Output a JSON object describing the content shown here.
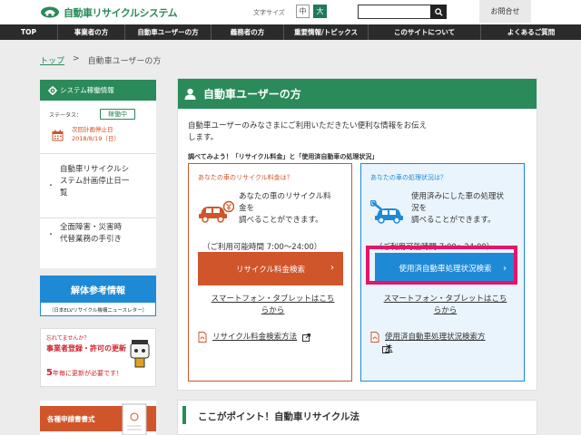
{
  "header": {
    "logo_text": "自動車リサイクルシステム",
    "font_size_label": "文字サイズ",
    "font_size_medium": "中",
    "font_size_large": "大",
    "search_placeholder": "",
    "inquiry": "お問合せ"
  },
  "nav": {
    "items": [
      "TOP",
      "事業者の方",
      "自動車ユーザーの方",
      "義務者の方",
      "重要情報/トピックス",
      "このサイトについて",
      "よくあるご質問"
    ]
  },
  "breadcrumb": {
    "home": "トップ",
    "separator": ">",
    "current": "自動車ユーザーの方"
  },
  "sidebar": {
    "status_title": "システム稼働情報",
    "status_label": "ステータス：",
    "status_value": "稼働中",
    "next_stop_1": "次回計画停止日",
    "next_stop_2": "2018/8/19（日）",
    "links": [
      {
        "line1": "自動車リサイクルシ",
        "line2": "ステム計画停止日一",
        "line3": "覧"
      },
      {
        "line1": "全面障害・災害時",
        "line2": "代替業務の手引き"
      }
    ],
    "ref_title": "解体参考情報",
    "ref_sub": "（日本ELVリサイクル機構ニュースレター）",
    "reminder_1": "忘れてませんか？",
    "reminder_2a": "事業者登録・許可の更新",
    "reminder_3a": "5",
    "reminder_3b": "年毎に更新が必要です！",
    "forms_title": "各種申請書書式"
  },
  "main": {
    "title": "自動車ユーザーの方",
    "intro_1": "自動車ユーザーのみなさまにご利用いただきたい便利な情報をお伝え",
    "intro_2": "します。",
    "check_head": "調べてみよう！「リサイクル料金」と「使用済自動車の処理状況」",
    "left": {
      "question": "あなたの車のリサイクル料金は？",
      "desc_1": "あなたの車のリサイクル料",
      "desc_2": "金を",
      "desc_3": "調べることができます。",
      "hours": "（ご利用可能時間 7:00〜24:00）",
      "button": "リサイクル料金検索",
      "sp_1": "スマートフォン・タブレットはこち",
      "sp_2": "らから",
      "pdf": "リサイクル料金検索方法"
    },
    "right": {
      "question": "あなたの車の処理状況は？",
      "desc_1": "使用済みにした車の処理状",
      "desc_2": "況を",
      "desc_3": "調べることができます。",
      "hours": "（ご利用可能時間 7:00〜24:00）",
      "button": "使用済自動車処理状況検索",
      "sp_1": "スマートフォン・タブレットはこち",
      "sp_2": "らから",
      "pdf_1": "使用済自動車処理状況検索方",
      "pdf_2": "法"
    },
    "point_title": "ここがポイント！自動車リサイクル法"
  },
  "colors": {
    "brand_green": "#2a8a5a",
    "orange": "#d0552a",
    "blue": "#1e8ad6",
    "highlight": "#e6156a"
  }
}
